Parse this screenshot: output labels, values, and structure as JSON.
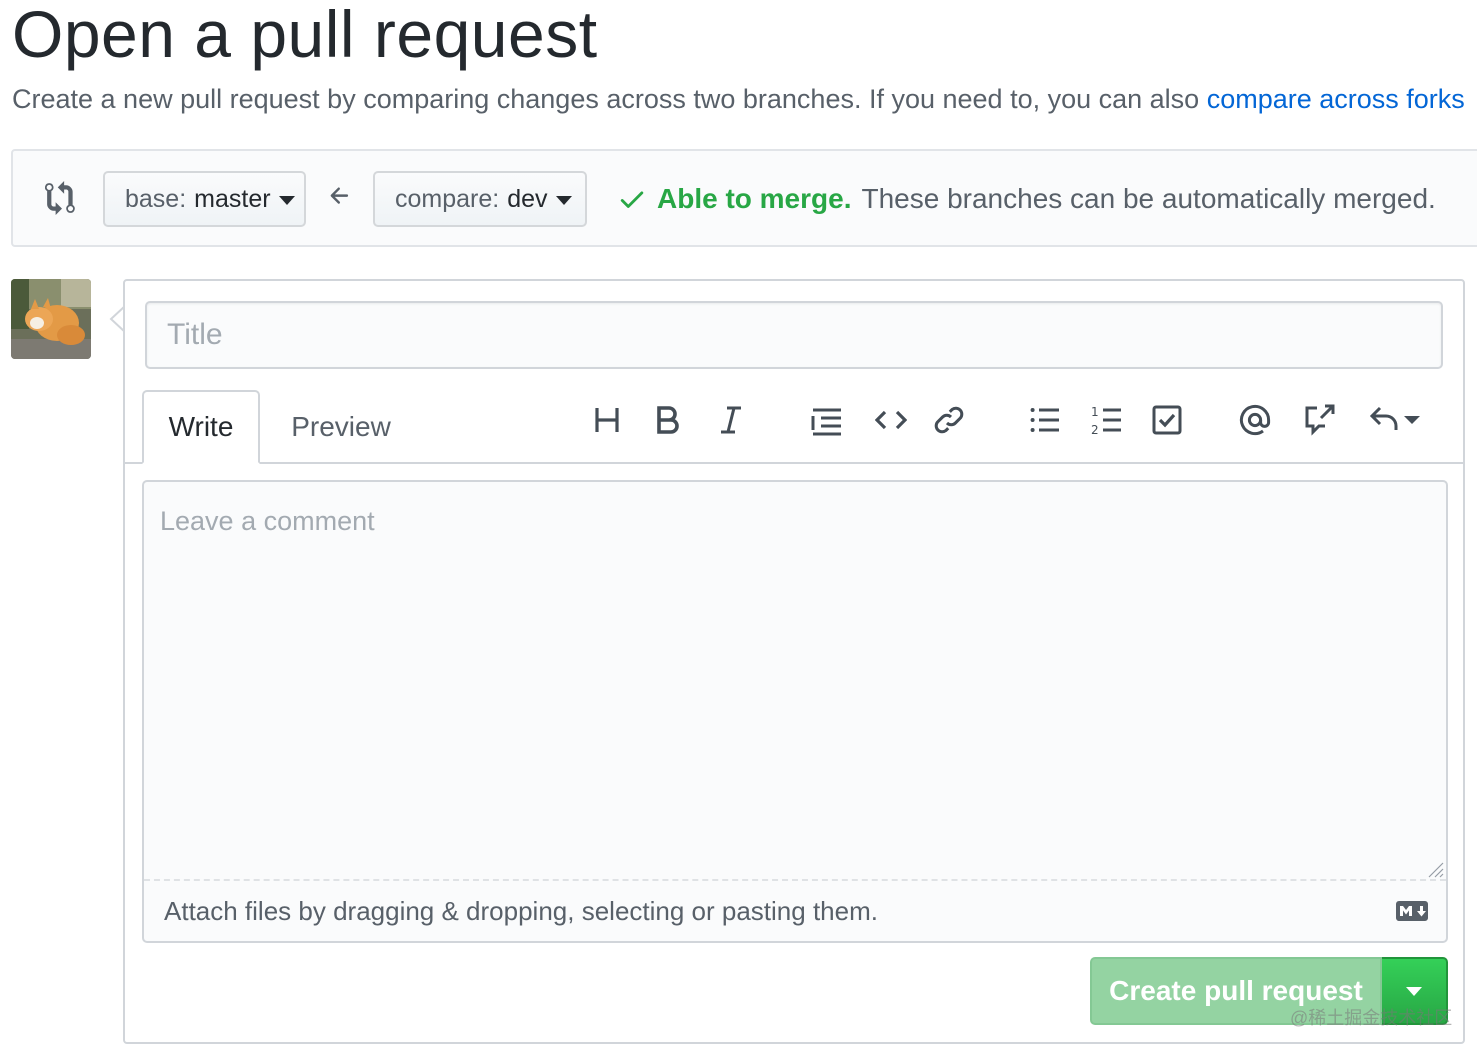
{
  "page": {
    "title": "Open a pull request",
    "subtitle": "Create a new pull request by comparing changes across two branches. If you need to, you can also ",
    "subtitle_link": "compare across forks"
  },
  "range": {
    "base_prefix": "base:",
    "base_branch": "master",
    "compare_prefix": "compare:",
    "compare_branch": "dev",
    "merge_status": "Able to merge.",
    "merge_description": "These branches can be automatically merged."
  },
  "form": {
    "title_placeholder": "Title",
    "tabs": [
      "Write",
      "Preview"
    ],
    "toolbar": [
      "heading-icon",
      "bold-icon",
      "italic-icon",
      "quote-icon",
      "code-icon",
      "link-icon",
      "bulleted-list-icon",
      "numbered-list-icon",
      "task-list-icon",
      "mention-icon",
      "cross-reference-icon",
      "reply-icon"
    ],
    "comment_placeholder": "Leave a comment",
    "attach_text": "Attach files by dragging & dropping, selecting or pasting them.",
    "submit_label": "Create pull request"
  },
  "watermark": "@稀土掘金技术社区",
  "colors": {
    "link": "#0366d6",
    "success": "#28a745",
    "submit_disabled": "#94d3a2"
  }
}
